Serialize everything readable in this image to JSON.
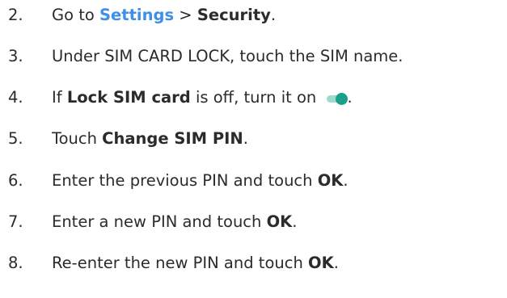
{
  "colors": {
    "text": "#2b2b2b",
    "link": "#3d8fe8",
    "toggle_track": "#9fd8cf",
    "toggle_thumb": "#1aa08a"
  },
  "steps": [
    {
      "number": "2.",
      "parts": {
        "a": "Go to ",
        "b": "Settings",
        "c": " > ",
        "d": "Security",
        "e": "."
      }
    },
    {
      "number": "3.",
      "parts": {
        "a": "Under SIM CARD LOCK, touch the SIM name."
      }
    },
    {
      "number": "4.",
      "parts": {
        "a": "If ",
        "b": "Lock SIM card",
        "c": " is off, turn it on ",
        "e": "."
      },
      "icon": "toggle-on-icon"
    },
    {
      "number": "5.",
      "parts": {
        "a": "Touch ",
        "b": "Change SIM PIN",
        "c": "."
      }
    },
    {
      "number": "6.",
      "parts": {
        "a": "Enter the previous PIN and touch ",
        "b": "OK",
        "c": "."
      }
    },
    {
      "number": "7.",
      "parts": {
        "a": "Enter a new PIN and touch ",
        "b": "OK",
        "c": "."
      }
    },
    {
      "number": "8.",
      "parts": {
        "a": "Re-enter the new PIN and touch ",
        "b": "OK",
        "c": "."
      }
    }
  ]
}
